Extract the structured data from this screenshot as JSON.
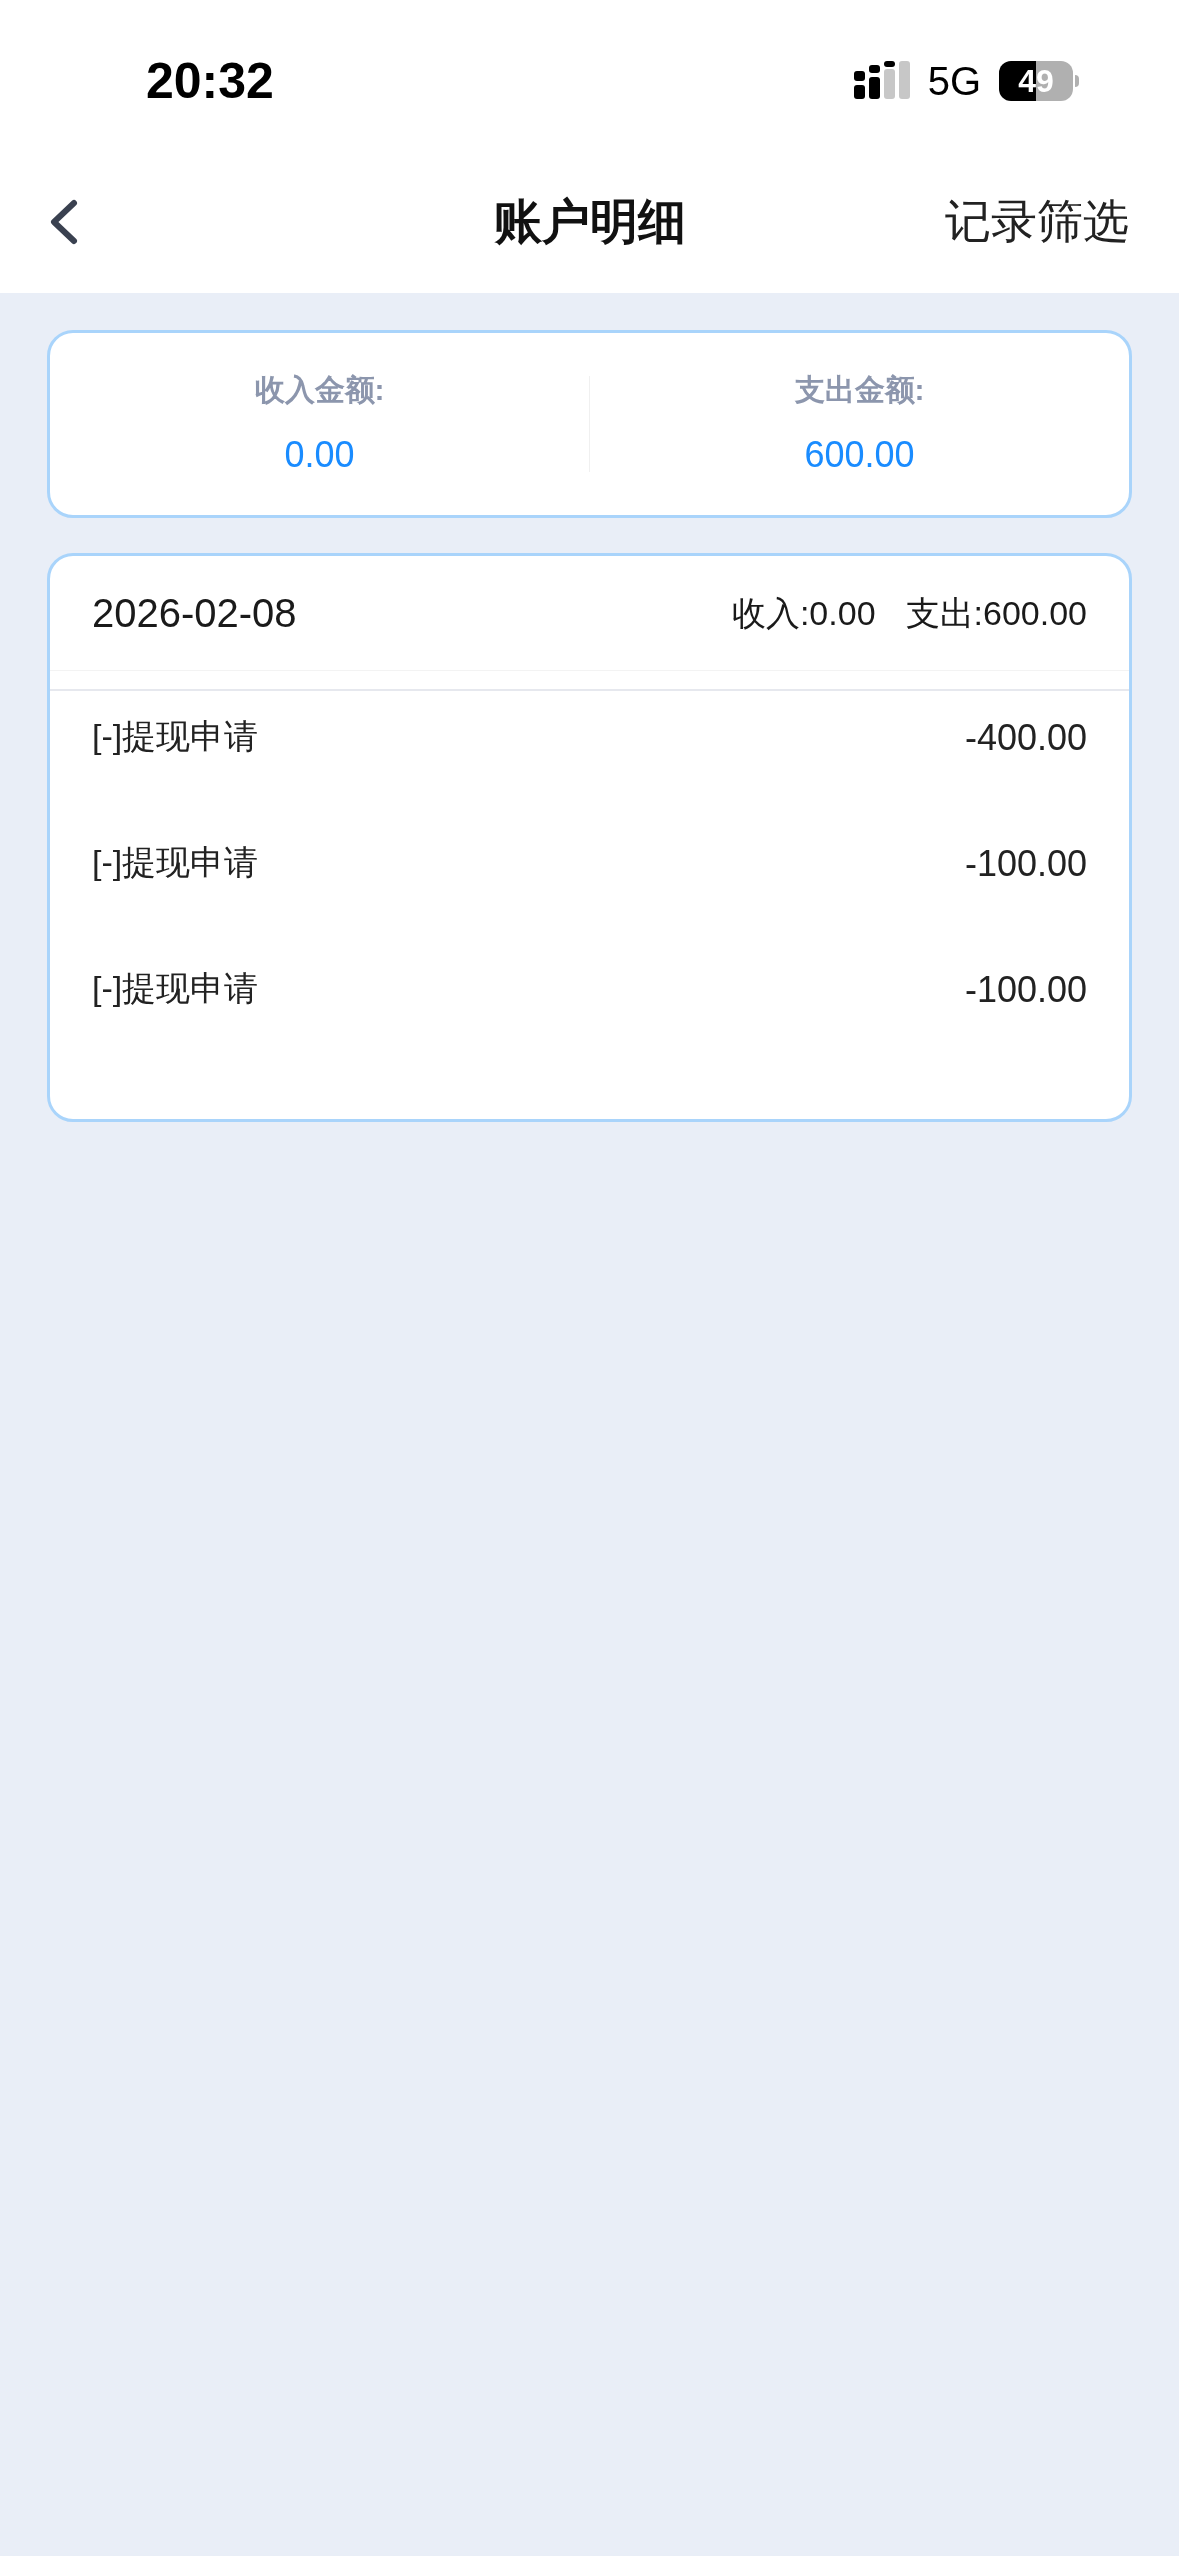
{
  "status_bar": {
    "time": "20:32",
    "network": "5G",
    "battery": "49"
  },
  "header": {
    "title": "账户明细",
    "action": "记录筛选"
  },
  "summary": [
    {
      "label": "收入金额:",
      "value": "0.00"
    },
    {
      "label": "支出金额:",
      "value": "600.00"
    }
  ],
  "day": {
    "date": "2026-02-08",
    "income": "收入:0.00",
    "expense": "支出:600.00",
    "rows": [
      {
        "title": "[-]提现申请",
        "amount": "-400.00"
      },
      {
        "title": "[-]提现申请",
        "amount": "-100.00"
      },
      {
        "title": "[-]提现申请",
        "amount": "-100.00"
      }
    ]
  }
}
